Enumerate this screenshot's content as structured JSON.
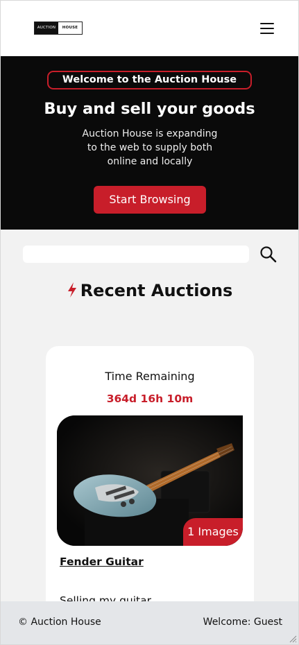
{
  "header": {
    "logo_left": "AUCTION",
    "logo_right": "HOUSE",
    "menu_icon": "hamburger-menu-icon"
  },
  "hero": {
    "badge": "Welcome to the Auction House",
    "title": "Buy and sell your goods",
    "description": "Auction House is expanding to the web to supply both online and locally",
    "cta_label": "Start Browsing"
  },
  "search": {
    "placeholder": "",
    "value": "",
    "icon": "magnifier-icon"
  },
  "recent": {
    "title": "Recent Auctions",
    "icon": "lightning-bolt-icon"
  },
  "listings": [
    {
      "time_label": "Time Remaining",
      "time_remaining": "364d 16h 10m",
      "image_count": "1 Images",
      "title": "Fender Guitar",
      "description": "Selling my guitar"
    }
  ],
  "footer": {
    "copyright": "© Auction House",
    "welcome": "Welcome: Guest"
  },
  "colors": {
    "accent": "#c81e2a",
    "hero_background": "#0a0a0a",
    "page_background": "#f2f2f2",
    "footer_background": "#e4e6e9"
  }
}
